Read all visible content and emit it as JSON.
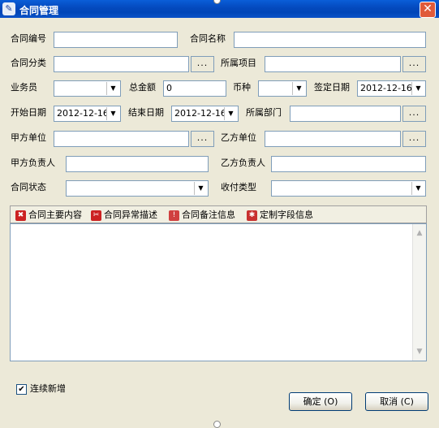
{
  "window": {
    "title": "合同管理"
  },
  "fields": {
    "contract_no_label": "合同编号",
    "contract_name_label": "合同名称",
    "contract_category_label": "合同分类",
    "project_label": "所属项目",
    "salesperson_label": "业务员",
    "total_amount_label": "总金额",
    "total_amount_value": "0",
    "currency_label": "币种",
    "sign_date_label": "签定日期",
    "sign_date_value": "2012-12-16",
    "start_date_label": "开始日期",
    "start_date_value": "2012-12-16",
    "end_date_label": "结束日期",
    "end_date_value": "2012-12-16",
    "department_label": "所属部门",
    "party_a_label": "甲方单位",
    "party_b_label": "乙方单位",
    "party_a_person_label": "甲方负责人",
    "party_b_person_label": "乙方负责人",
    "status_label": "合同状态",
    "payment_type_label": "收付类型",
    "browse_label": "..."
  },
  "tabs": [
    {
      "label": "合同主要内容",
      "color": "#cc2222"
    },
    {
      "label": "合同异常描述",
      "color": "#cc2222"
    },
    {
      "label": "合同备注信息",
      "color": "#d04040"
    },
    {
      "label": "定制字段信息",
      "color": "#c83030"
    }
  ],
  "footer": {
    "continuous_add_label": "连续新增",
    "continuous_add_checked": true,
    "ok_label": "确定 (O)",
    "cancel_label": "取消 (C)"
  }
}
